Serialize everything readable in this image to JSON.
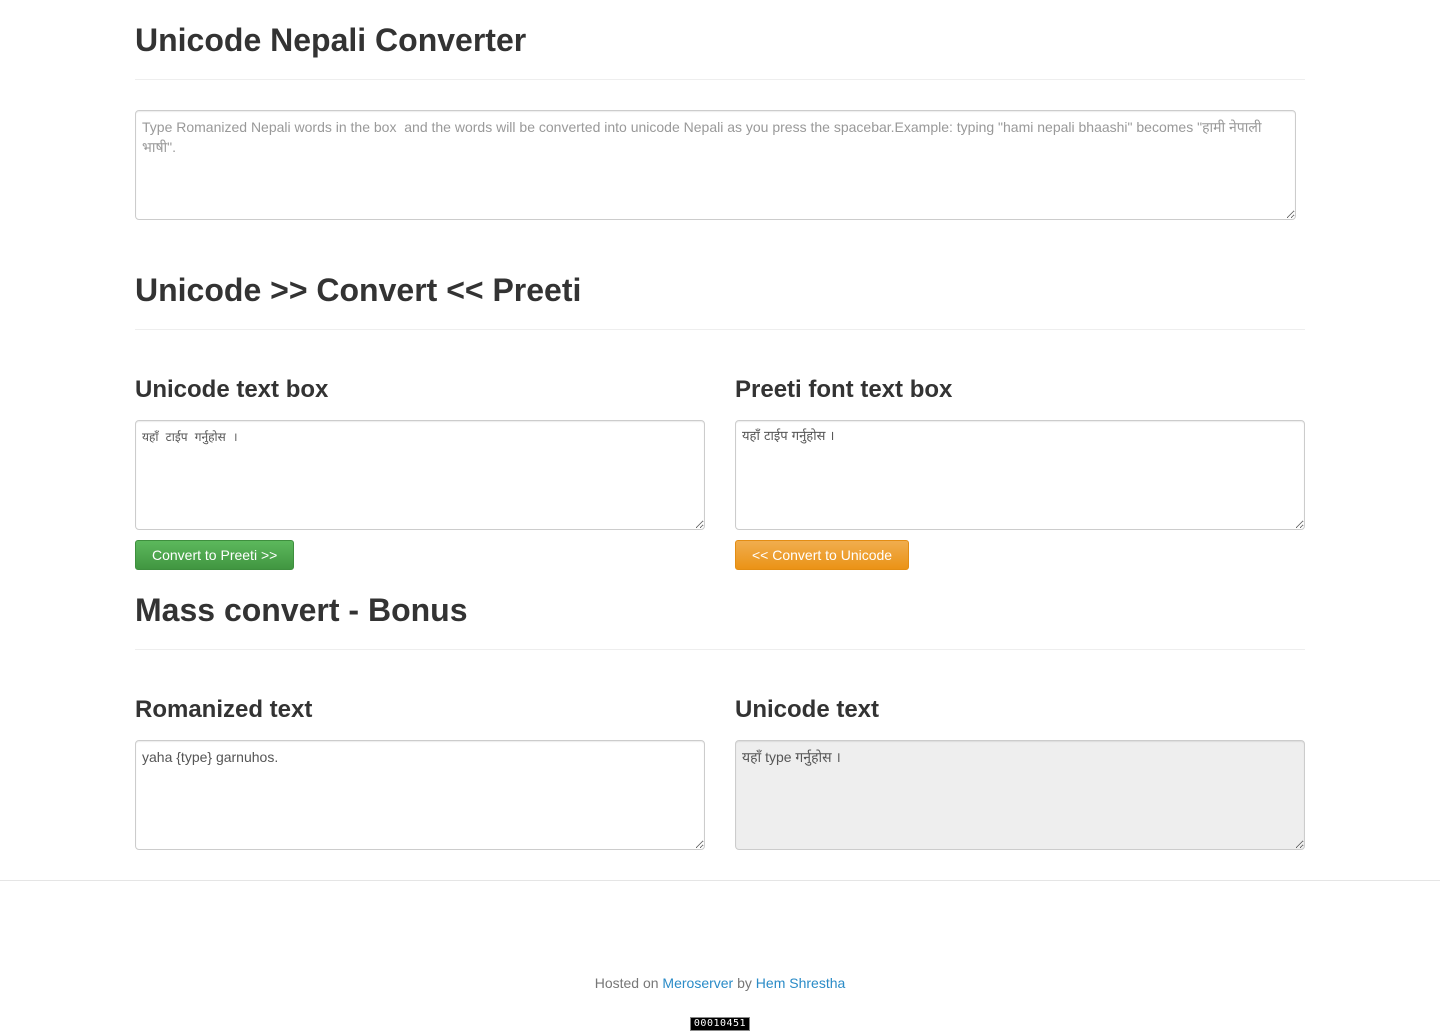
{
  "sections": {
    "converter_title": "Unicode Nepali Converter",
    "preeti_title": "Unicode >> Convert << Preeti",
    "mass_title": "Mass convert - Bonus"
  },
  "main_input": {
    "placeholder": "Type Romanized Nepali words in the box  and the words will be converted into unicode Nepali as you press the spacebar.Example: typing \"hami nepali bhaashi\" becomes \"हामी नेपाली भाषी\".",
    "value": ""
  },
  "unicode_box": {
    "heading": "Unicode text box",
    "value": "यहाँ टाईप गर्नुहोस ।"
  },
  "preeti_box": {
    "heading": "Preeti font text box",
    "value": "यहाँ टाईप गर्नुहोस ।"
  },
  "buttons": {
    "to_preeti": "Convert to Preeti >>",
    "to_unicode": "<< Convert to Unicode"
  },
  "romanized_box": {
    "heading": "Romanized text",
    "value": "yaha {type} garnuhos."
  },
  "unicode_output_box": {
    "heading": "Unicode text",
    "value": "यहाँ type गर्नुहोस ।"
  },
  "footer": {
    "hosted_on": "Hosted on",
    "host_link": "Meroserver",
    "by": "by",
    "author_link": "Hem Shrestha",
    "counter": "00010451"
  },
  "colors": {
    "success": "#5cb85c",
    "warning": "#f0ad4e",
    "link": "#2a8bc7"
  }
}
